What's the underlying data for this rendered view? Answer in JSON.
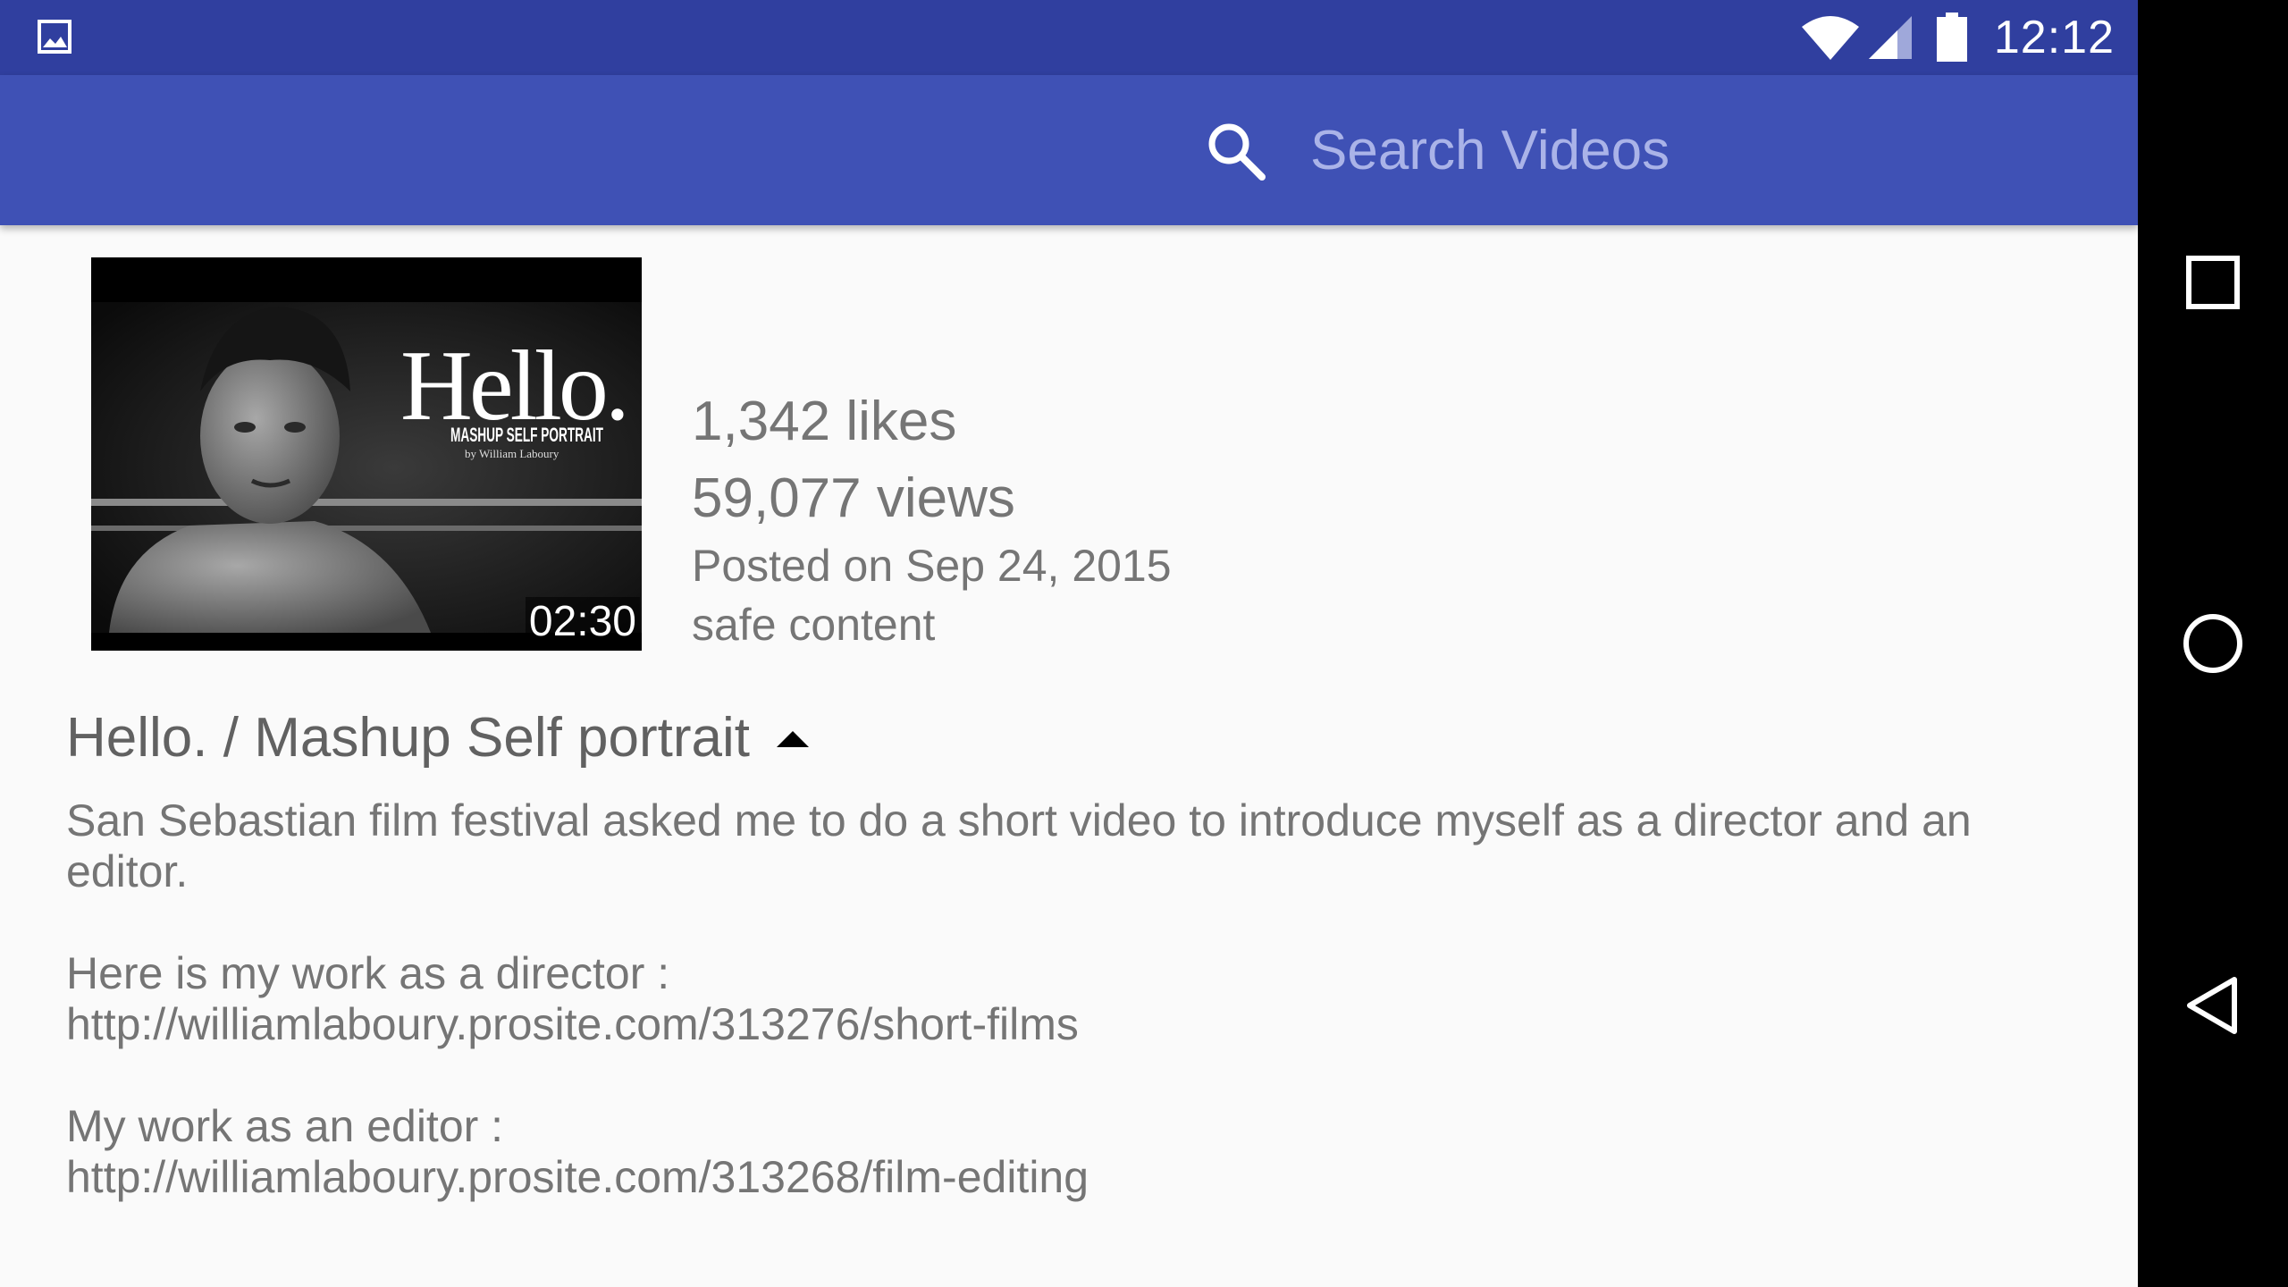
{
  "status_bar": {
    "time": "12:12",
    "icons": [
      "image-notification-icon",
      "wifi-icon",
      "cell-signal-icon",
      "battery-icon"
    ]
  },
  "toolbar": {
    "search_icon": "search-icon",
    "search_placeholder": "Search Videos",
    "search_value": ""
  },
  "video": {
    "thumbnail": {
      "title_text": "Hello.",
      "subtitle_text": "MASHUP SELF PORTRAIT",
      "byline_text": "by William Laboury"
    },
    "duration": "02:30",
    "likes": "1,342 likes",
    "views": "59,077 views",
    "posted": "Posted on Sep 24, 2015",
    "safety": "safe content",
    "title": "Hello. / Mashup Self portrait",
    "title_toggle_icon": "caret-up-icon",
    "description": {
      "intro_line1": "San Sebastian film festival asked me to do a short video to introduce myself as a director and an",
      "intro_line2": "editor.",
      "director_label": "Here is my work as a director :",
      "director_url": "http://williamlaboury.prosite.com/313276/short-films",
      "editor_label": "My work as an editor :",
      "editor_url": "http://williamlaboury.prosite.com/313268/film-editing"
    }
  },
  "nav_bar": {
    "buttons": [
      "recents-square-icon",
      "home-circle-icon",
      "back-triangle-icon"
    ]
  },
  "colors": {
    "status_bar": "#303f9f",
    "toolbar": "#3f51b5",
    "background": "#fafafa",
    "text_secondary": "#757575"
  }
}
